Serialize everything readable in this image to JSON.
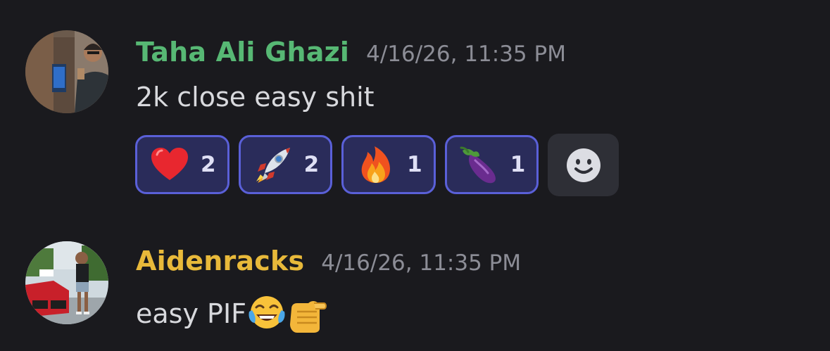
{
  "messages": [
    {
      "username": "Taha Ali Ghazi",
      "username_color": "#57b874",
      "timestamp": "4/16/26, 11:35 PM",
      "text": "2k close easy shit",
      "reactions": [
        {
          "emoji": "red-heart-icon",
          "count": "2"
        },
        {
          "emoji": "rocket-icon",
          "count": "2"
        },
        {
          "emoji": "fire-icon",
          "count": "1"
        },
        {
          "emoji": "eggplant-icon",
          "count": "1"
        }
      ],
      "add_reaction_icon": "smiley-face-icon"
    },
    {
      "username": "Aidenracks",
      "username_color": "#e8b93a",
      "timestamp": "4/16/26, 11:35 PM",
      "text": "easy PIF",
      "inline_emojis": [
        "face-with-tears-of-joy-icon",
        "fist-pointing-icon"
      ]
    }
  ],
  "colors": {
    "background": "#1a1a1e",
    "reaction_border": "#5a60d8",
    "reaction_bg": "#2a2c5a",
    "timestamp": "#8c8d96",
    "message_text": "#d8d9dd"
  }
}
